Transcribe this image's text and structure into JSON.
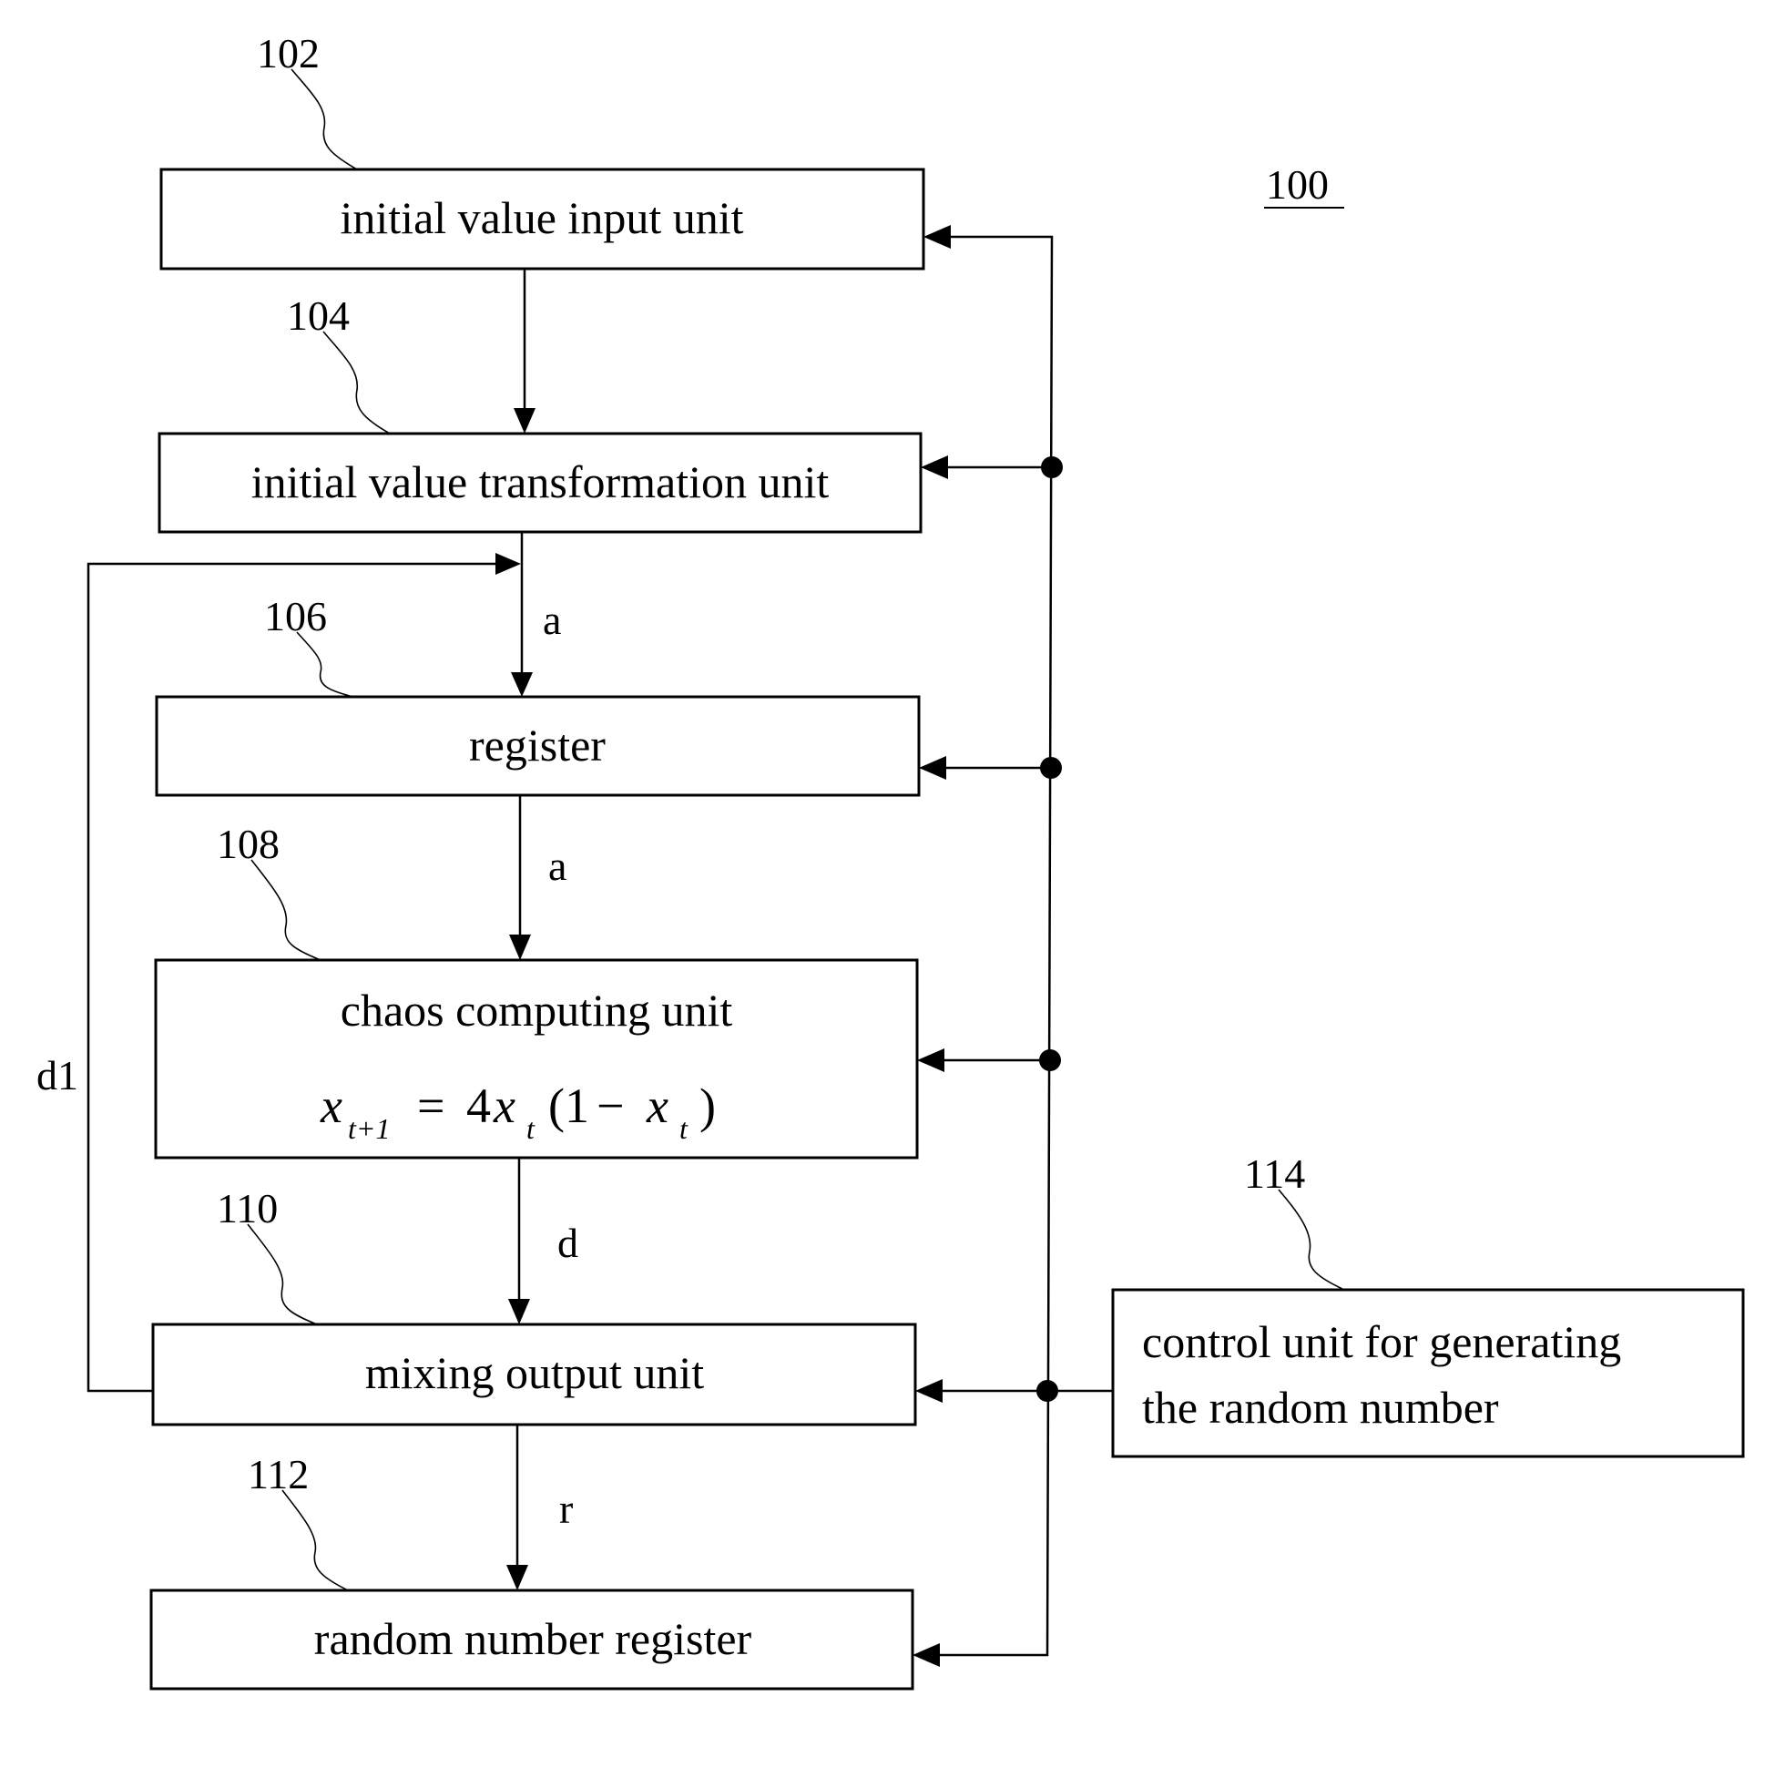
{
  "figure": {
    "reference": "100",
    "blocks": [
      {
        "ref": "102",
        "label": "initial value input unit"
      },
      {
        "ref": "104",
        "label": "initial value transformation unit"
      },
      {
        "ref": "106",
        "label": "register"
      },
      {
        "ref": "108",
        "label": "chaos computing unit",
        "formula": {
          "lhs_var": "x",
          "lhs_sub": "t+1",
          "eq": "=",
          "coef": "4",
          "var1": "x",
          "sub1": "t",
          "paren_open": "(1",
          "minus": "−",
          "var2": "x",
          "sub2": "t",
          "paren_close": ")"
        }
      },
      {
        "ref": "110",
        "label": "mixing output unit"
      },
      {
        "ref": "112",
        "label": "random number register"
      },
      {
        "ref": "114",
        "label_line1": "control unit for generating",
        "label_line2": "the random number"
      }
    ],
    "signals": {
      "transform_to_register": "a",
      "register_to_chaos": "a",
      "chaos_to_mixing": "d",
      "mixing_to_random_register": "r",
      "feedback": "d1"
    }
  }
}
